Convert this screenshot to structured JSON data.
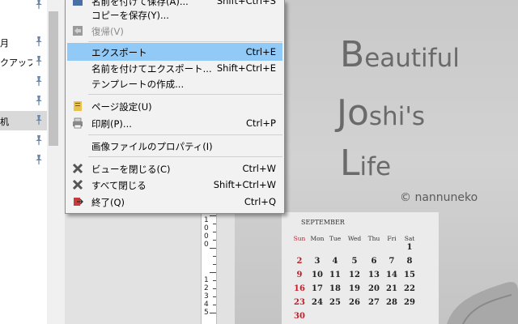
{
  "left_panel": {
    "items": [
      {
        "text": ""
      },
      {
        "text": "月"
      },
      {
        "text": "クアップ"
      },
      {
        "text": ""
      },
      {
        "text": ""
      },
      {
        "text": "机"
      },
      {
        "text": ""
      },
      {
        "text": ""
      }
    ]
  },
  "menu": {
    "items": [
      {
        "label": "名前を付けて保存(A)...",
        "shortcut": "Shift+Ctrl+S",
        "icon": "save-as-icon"
      },
      {
        "label": "コピーを保存(Y)...",
        "shortcut": "",
        "icon": ""
      },
      {
        "label": "復帰(V)",
        "shortcut": "",
        "icon": "revert-icon",
        "disabled": true
      },
      {
        "label": "エクスポート",
        "shortcut": "Ctrl+E",
        "icon": "",
        "highlighted": true
      },
      {
        "label": "名前を付けてエクスポート...",
        "shortcut": "Shift+Ctrl+E",
        "icon": ""
      },
      {
        "label": "テンプレートの作成...",
        "shortcut": "",
        "icon": ""
      },
      {
        "label": "ページ設定(U)",
        "shortcut": "",
        "icon": "page-setup-icon"
      },
      {
        "label": "印刷(P)...",
        "shortcut": "Ctrl+P",
        "icon": "printer-icon"
      },
      {
        "label": "画像ファイルのプロパティ(I)",
        "shortcut": "",
        "icon": ""
      },
      {
        "label": "ビューを閉じる(C)",
        "shortcut": "Ctrl+W",
        "icon": "close-view-icon"
      },
      {
        "label": "すべて閉じる",
        "shortcut": "Shift+Ctrl+W",
        "icon": "close-all-icon"
      },
      {
        "label": "終了(Q)",
        "shortcut": "Ctrl+Q",
        "icon": "quit-icon"
      }
    ]
  },
  "ruler": {
    "labels": [
      "1",
      "0",
      "0",
      "0",
      "1",
      "2",
      "3",
      "4",
      "5"
    ]
  },
  "canvas": {
    "title": {
      "line1_initial": "B",
      "line1_rest": "eautiful",
      "line2_initial": "Jo",
      "line2_rest": "shi's",
      "line3_initial": "L",
      "line3_rest": "ife"
    },
    "credit": "© nannuneko",
    "calendar": {
      "month": "SEPTEMBER",
      "weekdays": [
        "Sun",
        "Mon",
        "Tue",
        "Wed",
        "Thu",
        "Fri",
        "Sat"
      ],
      "weeks": [
        [
          "",
          "",
          "",
          "",
          "",
          "",
          "1"
        ],
        [
          "2",
          "3",
          "4",
          "5",
          "6",
          "7",
          "8"
        ],
        [
          "9",
          "10",
          "11",
          "12",
          "13",
          "14",
          "15"
        ],
        [
          "16",
          "17",
          "18",
          "19",
          "20",
          "21",
          "22"
        ],
        [
          "23",
          "24",
          "25",
          "26",
          "27",
          "28",
          "29"
        ],
        [
          "30",
          "",
          "",
          "",
          "",
          "",
          ""
        ]
      ],
      "holiday_color": "#c0202b"
    }
  },
  "colors": {
    "highlight": "#91c9f7",
    "menu_bg": "#f2f2f2"
  }
}
